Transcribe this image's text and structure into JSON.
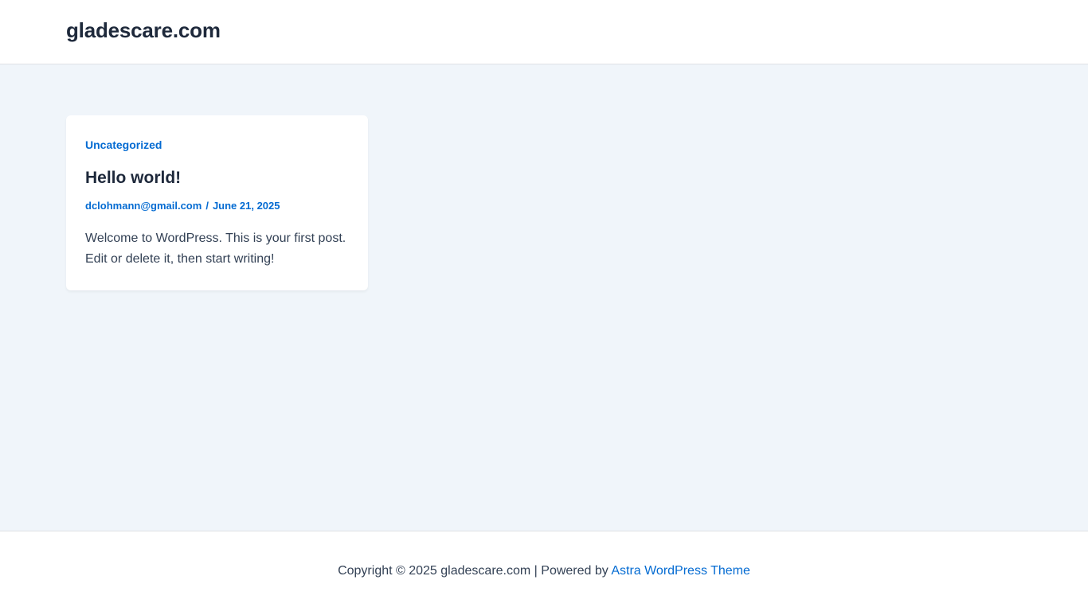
{
  "header": {
    "site_title": "gladescare.com"
  },
  "post": {
    "category": "Uncategorized",
    "title": "Hello world!",
    "author": "dclohmann@gmail.com",
    "meta_separator": "/",
    "date": "June 21, 2025",
    "excerpt": "Welcome to WordPress. This is your first post. Edit or delete it, then start writing!"
  },
  "footer": {
    "copyright_text": "Copyright © 2025 gladescare.com | Powered by ",
    "theme_link": "Astra WordPress Theme"
  },
  "colors": {
    "accent": "#046bd2",
    "heading": "#1e293b",
    "body_text": "#334155",
    "content_background": "#f0f5fa"
  }
}
